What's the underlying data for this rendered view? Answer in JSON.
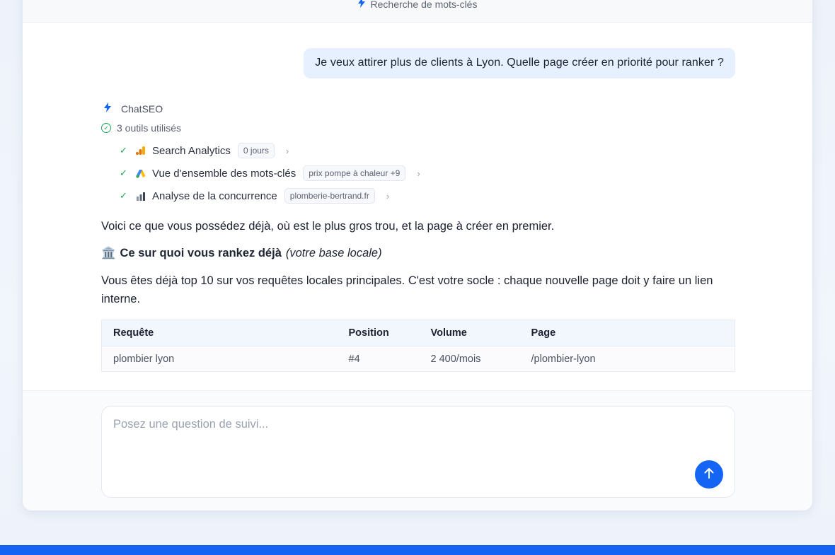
{
  "header": {
    "title": "Recherche de mots-clés",
    "icon": "bolt-icon"
  },
  "user_message": "Je veux attirer plus de clients à Lyon. Quelle page créer en priorité pour ranker ?",
  "assistant": {
    "name": "ChatSEO",
    "tools_summary": "3 outils utilisés",
    "tools": [
      {
        "label": "Search Analytics",
        "tag": "0 jours",
        "icon": "google-analytics-icon"
      },
      {
        "label": "Vue d'ensemble des mots-clés",
        "tag": "prix pompe à chaleur +9",
        "icon": "google-ads-icon"
      },
      {
        "label": "Analyse de la concurrence",
        "tag": "plomberie-bertrand.fr",
        "icon": "bar-chart-icon"
      }
    ],
    "intro": "Voici ce que vous possédez déjà, où est le plus gros trou, et la page à créer en premier.",
    "section_emoji": "🏛️",
    "section_title": "Ce sur quoi vous rankez déjà",
    "section_subtitle": "(votre base locale)",
    "section_text": "Vous êtes déjà top 10 sur vos requêtes locales principales. C'est votre socle : chaque nouvelle page doit y faire un lien interne.",
    "table": {
      "headers": [
        "Requête",
        "Position",
        "Volume",
        "Page"
      ],
      "rows": [
        [
          "plombier lyon",
          "#4",
          "2 400/mois",
          "/plombier-lyon"
        ]
      ]
    }
  },
  "composer": {
    "placeholder": "Posez une question de suivi..."
  },
  "colors": {
    "accent": "#1565f5",
    "success": "#22a457",
    "user_bubble": "#e6f0fe"
  }
}
